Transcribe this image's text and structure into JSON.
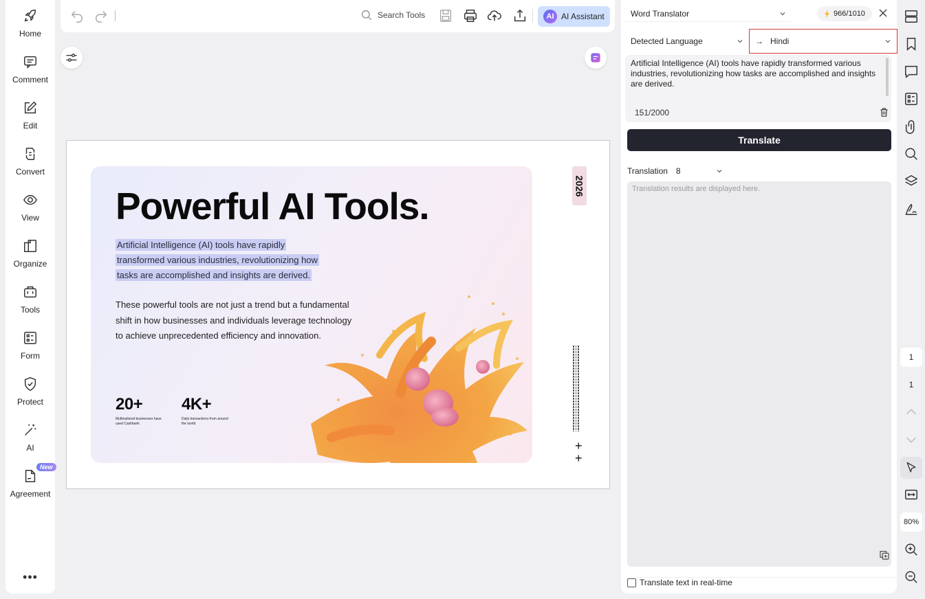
{
  "sidebar": {
    "items": [
      {
        "label": "Home",
        "icon": "rocket-icon"
      },
      {
        "label": "Comment",
        "icon": "comment-icon"
      },
      {
        "label": "Edit",
        "icon": "edit-icon"
      },
      {
        "label": "Convert",
        "icon": "convert-icon"
      },
      {
        "label": "View",
        "icon": "eye-icon"
      },
      {
        "label": "Organize",
        "icon": "organize-icon"
      },
      {
        "label": "Tools",
        "icon": "toolbox-icon"
      },
      {
        "label": "Form",
        "icon": "form-icon"
      },
      {
        "label": "Protect",
        "icon": "shield-icon"
      },
      {
        "label": "AI",
        "icon": "magic-wand-icon"
      },
      {
        "label": "Agreement",
        "icon": "agreement-icon",
        "badge": "New"
      }
    ],
    "more": "•••"
  },
  "toolbar": {
    "search_label": "Search Tools",
    "ai_assistant_label": "AI Assistant",
    "ai_logo_text": "AI"
  },
  "document": {
    "title": "Powerful AI Tools.",
    "paragraph1": [
      "Artificial Intelligence (AI) tools have rapidly",
      "transformed various industries, revolutionizing how",
      "tasks are accomplished and insights are derived."
    ],
    "paragraph2": "These powerful tools are not just a trend but a fundamental shift in how businesses and individuals leverage technology to achieve unprecedented efficiency and innovation.",
    "year": "2026",
    "stats": [
      {
        "value": "20+",
        "desc": "Multinational businesses have used Cashbank"
      },
      {
        "value": "4K+",
        "desc": "Daily transactions from around the world"
      }
    ],
    "plus": "+"
  },
  "translator": {
    "tool_name": "Word Translator",
    "credits": "966/1010",
    "source_language": "Detected Language",
    "arrow": "→",
    "target_language": "Hindi",
    "source_text": "Artificial Intelligence (AI) tools have rapidly transformed various industries, revolutionizing how tasks are accomplished and insights are derived.",
    "char_count": "151/2000",
    "translate_button": "Translate",
    "translation_label": "Translation",
    "translation_option": "8",
    "result_placeholder": "Translation results are displayed here.",
    "realtime_label": "Translate text in real-time"
  },
  "rail": {
    "current_page": "1",
    "total_pages": "1",
    "zoom": "80%"
  },
  "colors": {
    "accent_dark": "#22252e",
    "highlight": "#c9cdf3",
    "target_lang_border": "#d23b3b",
    "ai_button_bg": "#cfe0ff"
  }
}
